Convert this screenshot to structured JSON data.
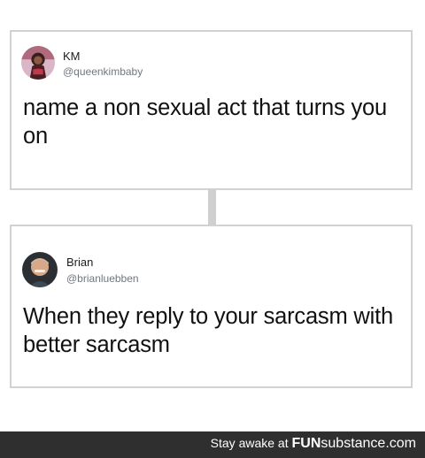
{
  "tweets": [
    {
      "name": "KM",
      "handle": "@queenkimbaby",
      "text": "name a non sexual act that turns you on"
    },
    {
      "name": "Brian",
      "handle": "@brianluebben",
      "text": "When they reply to your sarcasm with better sarcasm"
    }
  ],
  "footer": {
    "prefix": "Stay awake at",
    "brand_bold": "FUN",
    "brand_rest": "substance.com"
  },
  "colors": {
    "card_border": "#d2d2d2",
    "connector": "#cfcfcf",
    "footer_bg": "#2f2f2f",
    "handle_text": "#6f7780"
  }
}
